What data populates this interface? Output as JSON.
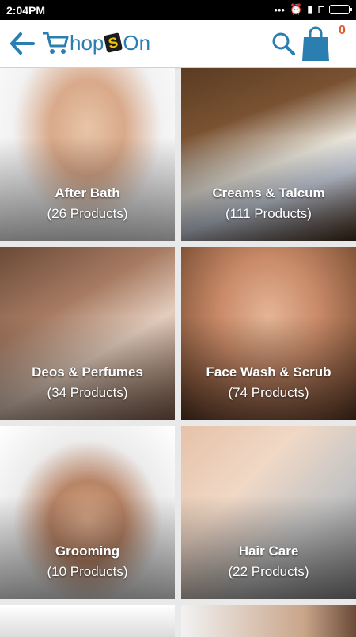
{
  "status_bar": {
    "time": "2:04PM",
    "network": "E",
    "icons": [
      "dots-icon",
      "alarm-icon",
      "signal-icon",
      "battery-icon"
    ]
  },
  "app_bar": {
    "back_icon": "arrow-left-icon",
    "logo": "ShopOn",
    "search_icon": "search-icon",
    "cart_icon": "shopping-bag-icon",
    "cart_count": "0"
  },
  "categories": [
    {
      "name": "After Bath",
      "count": "(26 Products)"
    },
    {
      "name": "Creams & Talcum",
      "count": "(111 Products)"
    },
    {
      "name": "Deos & Perfumes",
      "count": "(34 Products)"
    },
    {
      "name": "Face Wash & Scrub",
      "count": "(74 Products)"
    },
    {
      "name": "Grooming",
      "count": "(10 Products)"
    },
    {
      "name": "Hair Care",
      "count": "(22 Products)"
    }
  ],
  "colors": {
    "brand": "#2a7fb0",
    "cart_count": "#e4572e",
    "status_bar": "#000000"
  }
}
